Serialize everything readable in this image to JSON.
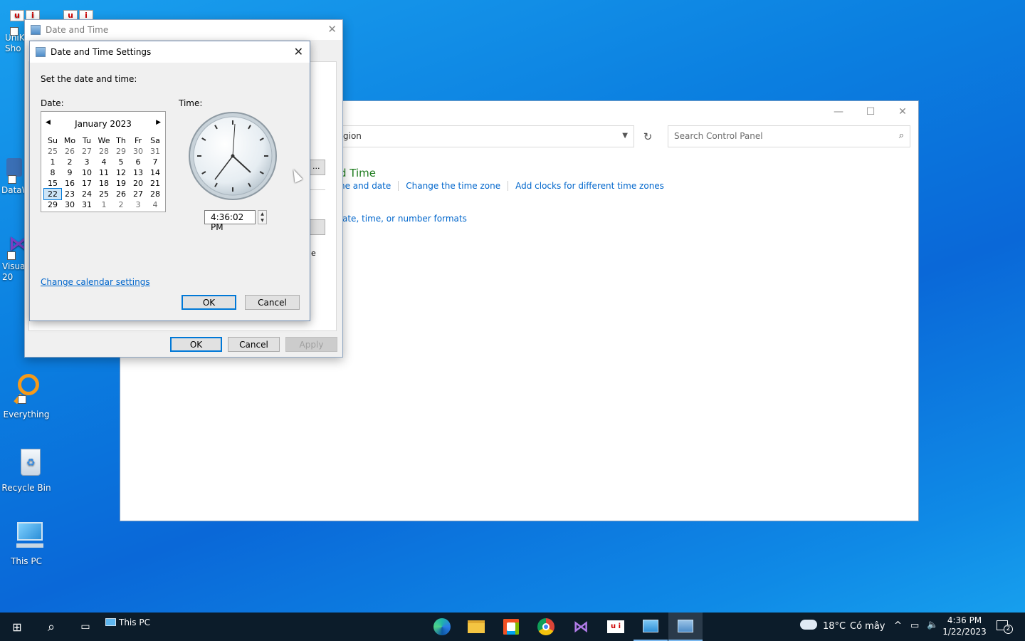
{
  "desktop": {
    "icons": [
      {
        "label": "UniK\nSho"
      },
      {
        "label": "DataW"
      },
      {
        "label": "Visual\n20"
      },
      {
        "label": "Everything"
      },
      {
        "label": "Recycle Bin"
      },
      {
        "label": "This PC"
      }
    ]
  },
  "control_panel": {
    "address_text": "gion",
    "search_placeholder": "Search Control Panel",
    "category_title": "d Time",
    "links": [
      "ne and date",
      "Change the time zone",
      "Add clocks for different time zones"
    ],
    "link2": "ate, time, or number formats",
    "ghost_btn_label": "...",
    "ghost_fragment": "e"
  },
  "date_time_dialog": {
    "title": "Date and Time",
    "ok_label": "OK",
    "cancel_label": "Cancel",
    "apply_label": "Apply"
  },
  "settings_dialog": {
    "title": "Date and Time Settings",
    "instruction": "Set the date and time:",
    "date_label": "Date:",
    "time_label": "Time:",
    "calendar": {
      "month_label": "January 2023",
      "weekdays": [
        "Su",
        "Mo",
        "Tu",
        "We",
        "Th",
        "Fr",
        "Sa"
      ],
      "weeks": [
        [
          "25",
          "26",
          "27",
          "28",
          "29",
          "30",
          "31"
        ],
        [
          "1",
          "2",
          "3",
          "4",
          "5",
          "6",
          "7"
        ],
        [
          "8",
          "9",
          "10",
          "11",
          "12",
          "13",
          "14"
        ],
        [
          "15",
          "16",
          "17",
          "18",
          "19",
          "20",
          "21"
        ],
        [
          "22",
          "23",
          "24",
          "25",
          "26",
          "27",
          "28"
        ],
        [
          "29",
          "30",
          "31",
          "1",
          "2",
          "3",
          "4"
        ]
      ],
      "selected_day": "22"
    },
    "time_value": "4:36:02 PM",
    "change_calendar_link": "Change calendar settings",
    "ok_label": "OK",
    "cancel_label": "Cancel"
  },
  "taskbar": {
    "this_pc_label": "This PC",
    "weather_temp": "18°C",
    "weather_text": "Có mây",
    "clock_time": "4:36 PM",
    "clock_date": "1/22/2023",
    "notification_count": "2"
  },
  "colors": {
    "accent": "#0078d7",
    "link": "#0066cc",
    "category_green": "#1e7c1e"
  }
}
